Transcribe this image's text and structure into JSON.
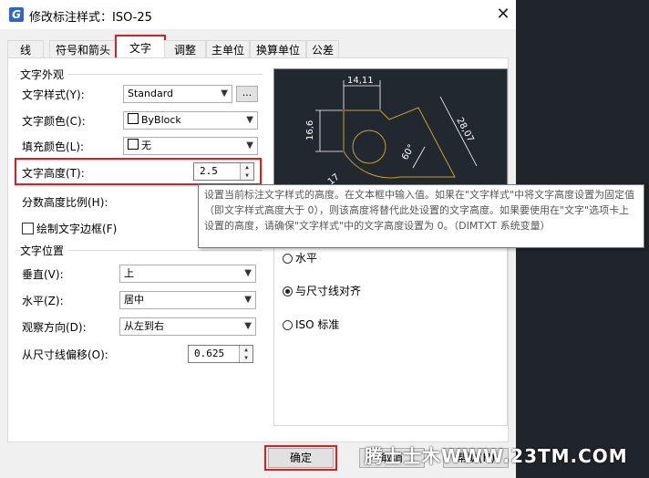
{
  "window": {
    "title": "修改标注样式：ISO-25",
    "app_icon": "G",
    "close_glyph": "✕"
  },
  "tabs": [
    "线",
    "符号和箭头",
    "文字",
    "调整",
    "主单位",
    "换算单位",
    "公差"
  ],
  "active_tab": "文字",
  "appearance": {
    "group_title": "文字外观",
    "style_label": "文字样式(Y):",
    "style_value": "Standard",
    "style_browse": "...",
    "color_label": "文字颜色(C):",
    "color_value": "ByBlock",
    "fill_label": "填充颜色(L):",
    "fill_value": "无",
    "height_label": "文字高度(T):",
    "height_value": "2.5",
    "fraction_label": "分数高度比例(H):",
    "frame_label": "绘制文字边框(F)"
  },
  "placement": {
    "group_title": "文字位置",
    "vertical_label": "垂直(V):",
    "vertical_value": "上",
    "horizontal_label": "水平(Z):",
    "horizontal_value": "居中",
    "view_label": "观察方向(D):",
    "view_value": "从左到右",
    "offset_label": "从尺寸线偏移(O):",
    "offset_value": "0.625"
  },
  "alignment": {
    "options": [
      "水平",
      "与尺寸线对齐",
      "ISO 标准"
    ],
    "selected": "与尺寸线对齐"
  },
  "preview": {
    "dim_top": "14,11",
    "dim_left": "16,6",
    "dim_right": "28,07",
    "dim_angle": "60°",
    "dim_bottom": "17"
  },
  "tooltip": "设置当前标注文字样式的高度。在文本框中输入值。如果在\"文字样式\"中将文字高度设置为固定值（即文字样式高度大于 0），则该高度将替代此处设置的文字高度。如果要使用在\"文字\"选项卡上设置的高度，请确保\"文字样式\"中的文字高度设置为 0。（DIMTXT 系统变量）",
  "buttons": {
    "ok": "确定",
    "cancel": "取消",
    "help": "帮助(H)"
  },
  "watermark": "腾士士木WWW.23TM.COM",
  "colors": {
    "highlight": "#e21c1c",
    "preview_bg": "#212830",
    "preview_geom": "#c9a227"
  }
}
